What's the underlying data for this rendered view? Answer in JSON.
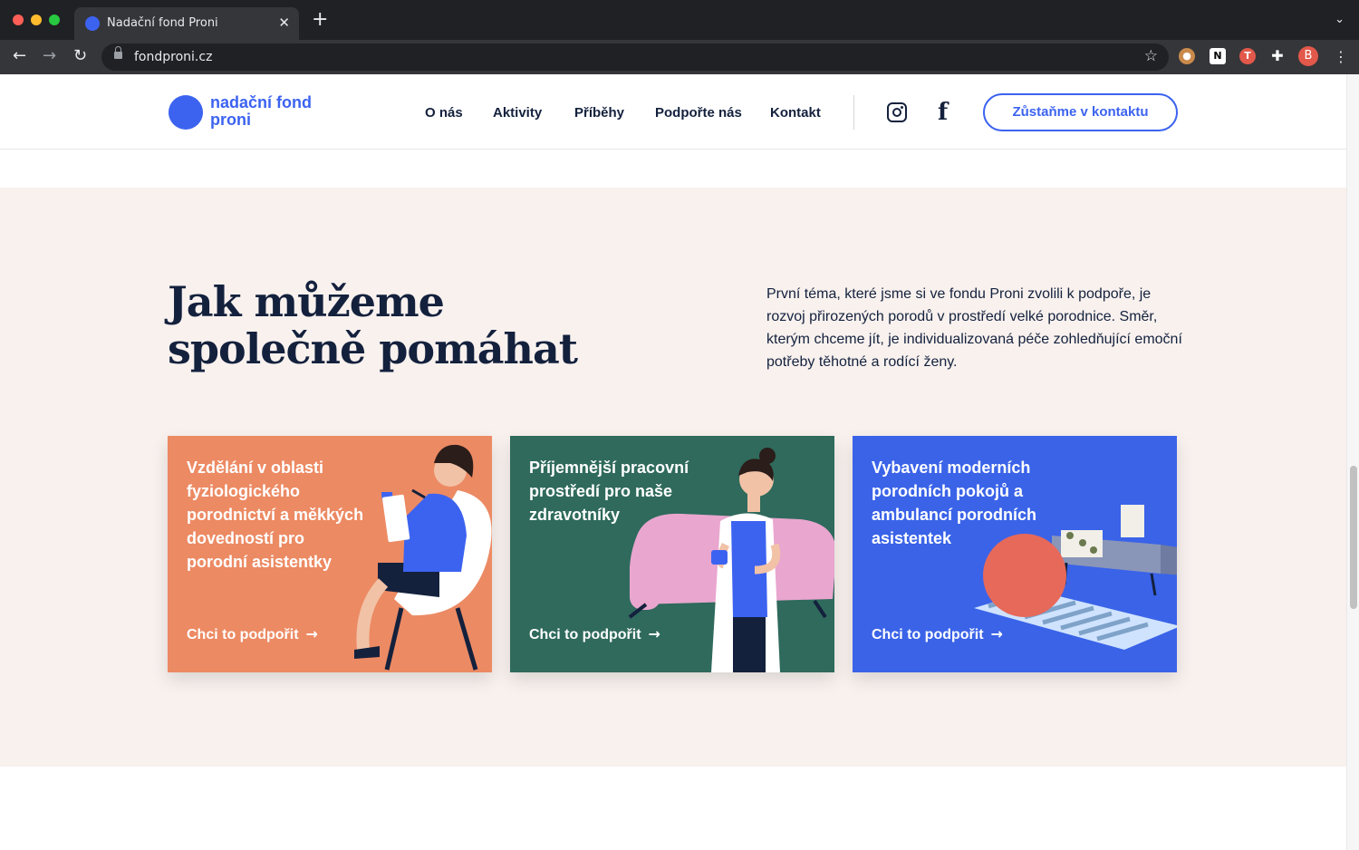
{
  "browser": {
    "tab_title": "Nadační fond Proni",
    "tab_close": "✕",
    "new_tab": "+",
    "tab_menu": "⌄",
    "url": "fondproni.cz",
    "profile_initial": "B",
    "icons": [
      "back-icon",
      "forward-icon",
      "reload-icon",
      "lock-icon",
      "star-icon",
      "cookie-extension-icon",
      "notion-extension-icon",
      "todoist-extension-icon",
      "puzzle-extension-icon",
      "kebab-menu-icon"
    ]
  },
  "header": {
    "logo_line1": "nadační fond",
    "logo_line2": "proni",
    "nav": [
      "O nás",
      "Aktivity",
      "Příběhy",
      "Podpořte nás",
      "Kontakt"
    ],
    "cta_label": "Zůstaňme v kontaktu",
    "brand_color": "#3c63f0"
  },
  "section": {
    "title_line1": "Jak můžeme",
    "title_line2": "společně pomáhat",
    "intro": "První téma, které jsme si ve fondu Proni zvolili k podpoře, je rozvoj přirozených porodů v prostředí velké porodnice. Směr, kterým chceme jít, je individualizovaná péče zohledňující emoční potřeby těhotné a rodící ženy.",
    "background": "#f8f1ee"
  },
  "cards": [
    {
      "title": [
        "Vzdělání v oblasti",
        "fyziologického",
        "porodnictví a měkkých",
        "dovedností pro",
        "porodní asistentky"
      ],
      "link": "Chci to podpořit",
      "arrow": "→",
      "color": "#ec8a63"
    },
    {
      "title": [
        "Příjemnější pracovní",
        "prostředí pro naše",
        "zdravotníky"
      ],
      "link": "Chci to podpořit",
      "arrow": "→",
      "color": "#2f6a5c"
    },
    {
      "title": [
        "Vybavení moderních",
        "porodních pokojů a",
        "ambulancí porodních",
        "asistentek"
      ],
      "link": "Chci to podpořit",
      "arrow": "→",
      "color": "#3a63e8"
    }
  ]
}
